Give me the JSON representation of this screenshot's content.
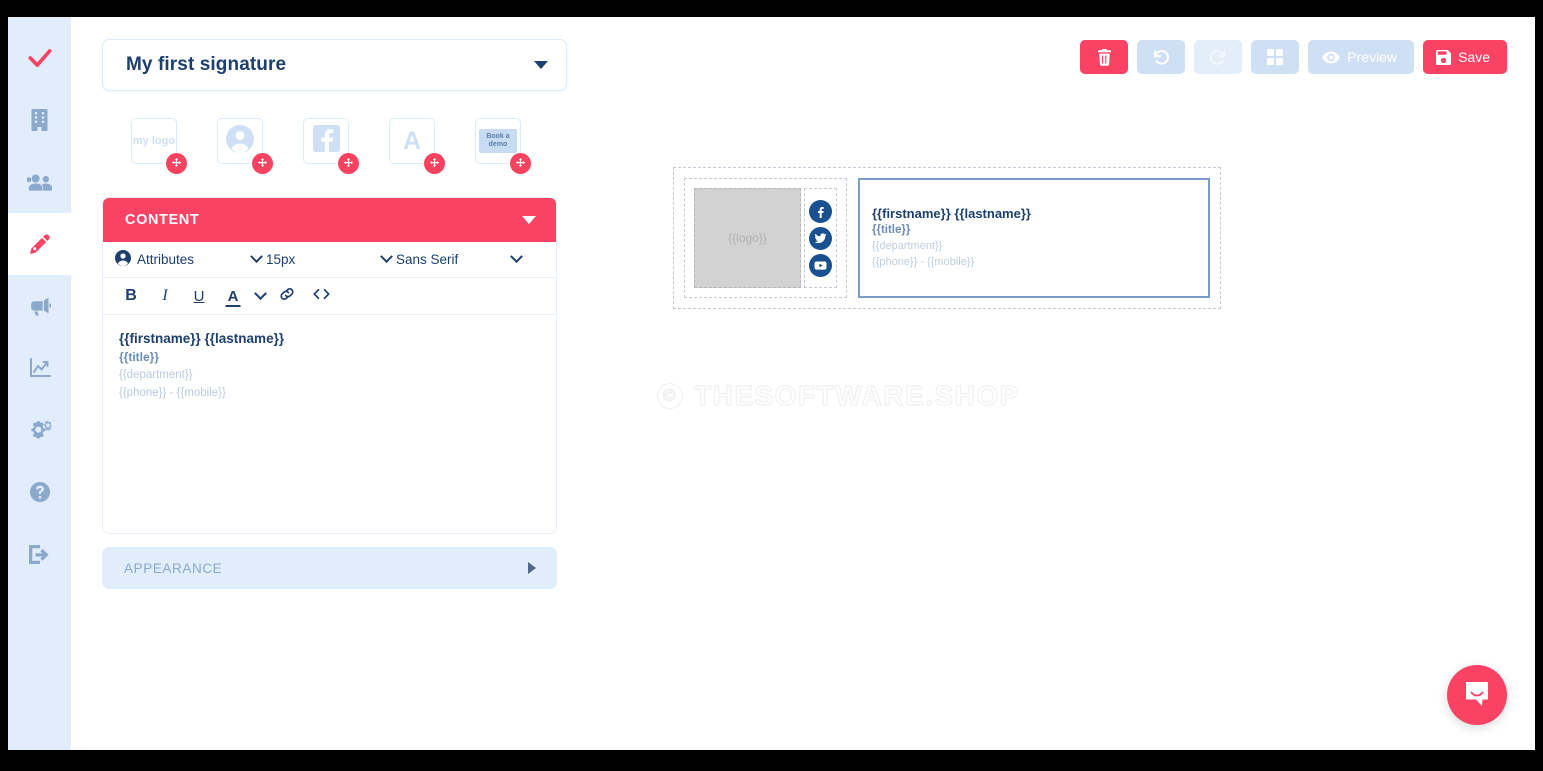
{
  "sidebar": {
    "items": [
      {
        "name": "brand-check",
        "icon": "check-icon",
        "active": false
      },
      {
        "name": "company",
        "icon": "building-icon",
        "active": false
      },
      {
        "name": "users",
        "icon": "users-icon",
        "active": false
      },
      {
        "name": "signatures",
        "icon": "pen-nib-icon",
        "active": true
      },
      {
        "name": "campaigns",
        "icon": "megaphone-icon",
        "active": false
      },
      {
        "name": "analytics",
        "icon": "chart-icon",
        "active": false
      },
      {
        "name": "settings",
        "icon": "gears-icon",
        "active": false
      },
      {
        "name": "help",
        "icon": "question-circle-icon",
        "active": false
      },
      {
        "name": "logout",
        "icon": "sign-out-icon",
        "active": false
      }
    ]
  },
  "actions": {
    "delete_label": "",
    "undo_label": "",
    "redo_label": "",
    "layout_label": "",
    "preview_label": "Preview",
    "save_label": "Save"
  },
  "signature_selector": {
    "value": "My first signature"
  },
  "elements": [
    {
      "id": "logo",
      "label": "my logo",
      "icon": "image-logo-icon"
    },
    {
      "id": "avatar",
      "label": "",
      "icon": "user-photo-icon"
    },
    {
      "id": "facebook",
      "label": "",
      "icon": "facebook-icon"
    },
    {
      "id": "text",
      "label": "A",
      "icon": "text-icon"
    },
    {
      "id": "button",
      "label": "Book a demo",
      "icon": "cta-button-icon"
    }
  ],
  "content_panel": {
    "title": "CONTENT",
    "toolbar": {
      "attributes_label": "Attributes",
      "font_size": "15px",
      "font_family": "Sans Serif",
      "bold_label": "B",
      "italic_label": "I",
      "underline_label": "U",
      "color_label": "A",
      "link_label": "",
      "code_label": ""
    },
    "editor": {
      "line1": "{{firstname}} {{lastname}}",
      "line2": "{{title}}",
      "line3": "{{department}}",
      "line4": "{{phone}} - {{mobile}}"
    }
  },
  "appearance_panel": {
    "title": "APPEARANCE"
  },
  "preview": {
    "logo_placeholder": "{{logo}}",
    "social": [
      {
        "name": "facebook",
        "icon": "facebook-icon"
      },
      {
        "name": "twitter",
        "icon": "twitter-icon"
      },
      {
        "name": "youtube",
        "icon": "youtube-icon"
      }
    ],
    "line1": "{{firstname}} {{lastname}}",
    "line2": "{{title}}",
    "line3": "{{department}}",
    "line4": "{{phone}} - {{mobile}}"
  },
  "watermark": {
    "symbol": "©",
    "text": "THESOFTWARE.SHOP"
  },
  "colors": {
    "accent": "#fa4264",
    "sidebar_bg": "#e1edfb",
    "navy": "#1c3f6e",
    "soft_blue": "#cfe0f5",
    "social_blue": "#19508f"
  }
}
